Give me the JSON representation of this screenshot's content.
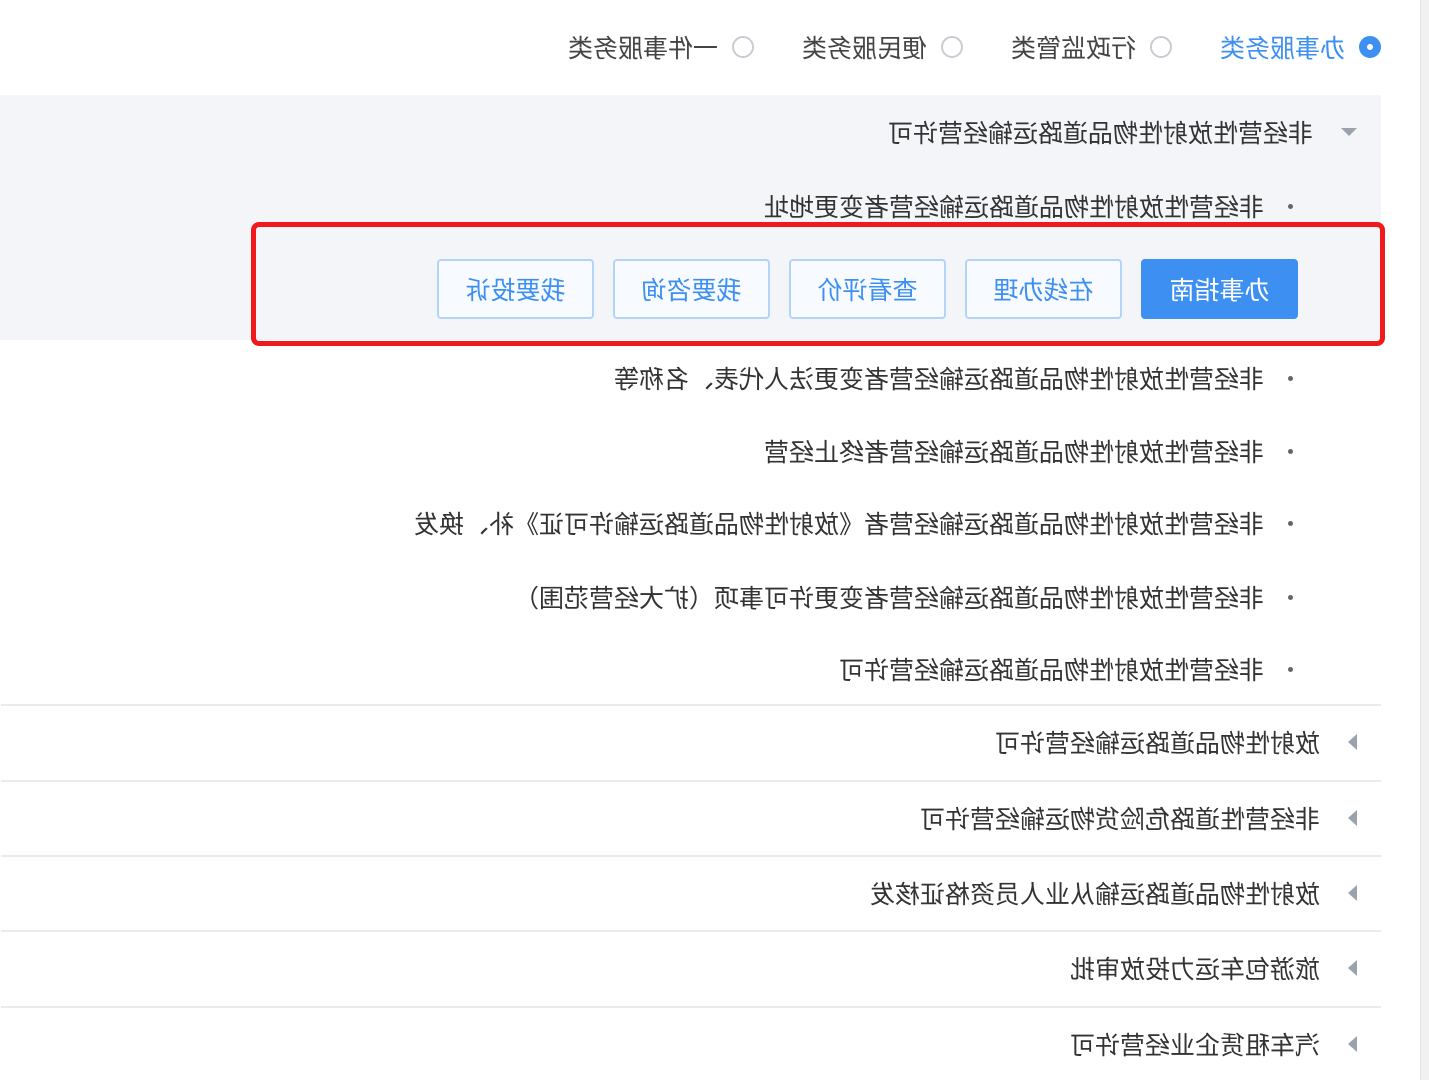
{
  "service_type_options": [
    {
      "label": "办事服务类",
      "selected": true
    },
    {
      "label": "行政监管类",
      "selected": false
    },
    {
      "label": "便民服务类",
      "selected": false
    },
    {
      "label": "一件事服务类",
      "selected": false
    }
  ],
  "expanded_category": {
    "title": "非经营性放射性物品道路运输经营许可",
    "items": [
      "非经营性放射性物品道路运输经营者变更地址",
      "非经营性放射性物品道路运输经营者变更法人代表、名称等",
      "非经营性放射性物品道路运输经营者终止经营",
      "非经营性放射性物品道路运输经营者《放射性物品道路运输许可证》补、换发",
      "非经营性放射性物品道路运输经营者变更许可事项（扩大经营范围）",
      "非经营性放射性物品道路运输经营许可"
    ]
  },
  "action_buttons": [
    {
      "label": "办事指南",
      "primary": true
    },
    {
      "label": "在线办理",
      "primary": false
    },
    {
      "label": "查看评价",
      "primary": false
    },
    {
      "label": "我要咨询",
      "primary": false
    },
    {
      "label": "我要投诉",
      "primary": false
    }
  ],
  "collapsed_categories": [
    "放射性物品道路运输经营许可",
    "非经营性道路危险货物运输经营许可",
    "放射性物品道路运输从业人员资格证核发",
    "旅游包车运力投放审批",
    "汽车租赁企业经营许可"
  ],
  "colors": {
    "accent": "#3d8ff2",
    "highlight_border": "#f0191c",
    "panel_bg": "#f3f5f8"
  }
}
